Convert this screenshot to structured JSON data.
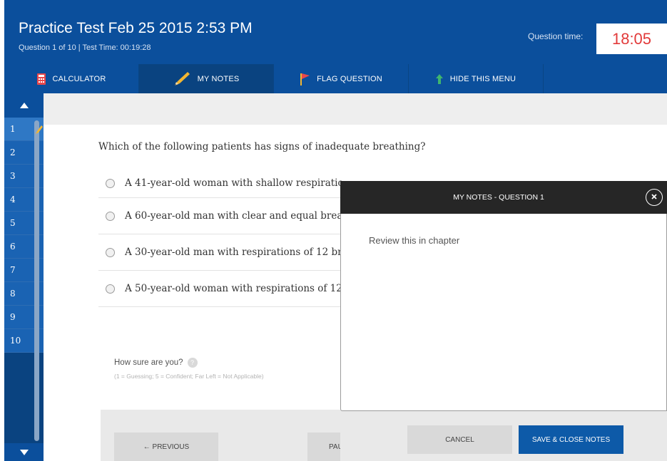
{
  "header": {
    "title": "Practice Test Feb 25 2015 2:53 PM",
    "subtitle": "Question 1 of 10 | Test Time: 00:19:28",
    "question_time_label": "Question time:",
    "question_time_value": "18:05"
  },
  "toolbar": {
    "calculator": {
      "label": "CALCULATOR",
      "icon": "calculator-icon"
    },
    "notes": {
      "label": "MY NOTES",
      "icon": "pencil-icon"
    },
    "flag": {
      "label": "FLAG QUESTION",
      "icon": "flag-icon"
    },
    "hide": {
      "label": "HIDE THIS MENU",
      "icon": "arrow-up-icon"
    }
  },
  "sidebar": {
    "current": "1",
    "questions": [
      "1",
      "2",
      "3",
      "4",
      "5",
      "6",
      "7",
      "8",
      "9",
      "10"
    ]
  },
  "question": {
    "text": "Which of the following patients has signs of inadequate breathing?",
    "answers": [
      "A 41-year-old woman with shallow respiratio",
      "A 60-year-old man with clear and equal brea",
      "A 30-year-old man with respirations of 12 br",
      "A 50-year-old woman with respirations of 12"
    ]
  },
  "confidence": {
    "label": "How sure are you?",
    "help": "?",
    "hint": "(1 = Guessing; 5 = Confident; Far Left = Not Applicable)"
  },
  "footer": {
    "previous_label": "← PREVIOUS",
    "pause_label": "PAU"
  },
  "notes": {
    "title": "MY NOTES - QUESTION 1",
    "text": "Review this in chapter",
    "cancel_label": "CANCEL",
    "save_label": "SAVE & CLOSE NOTES"
  },
  "colors": {
    "brand_blue": "#0b4f9c",
    "sidebar_blue": "#1a63b3",
    "timer_red": "#e23a3a",
    "save_blue": "#0d5aa8",
    "notes_header": "#262626"
  }
}
